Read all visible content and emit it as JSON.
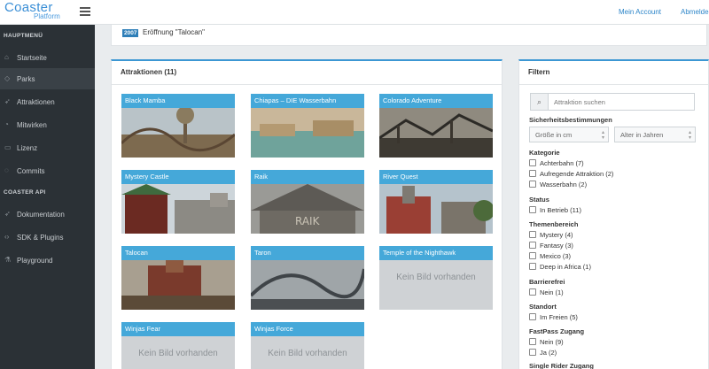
{
  "app": {
    "logo_main": "Coaster",
    "logo_sub": "Platform"
  },
  "topbar": {
    "account": "Mein Account",
    "logout": "Abmelde"
  },
  "sidebar": {
    "main_header": "HAUPTMENÜ",
    "main_items": [
      {
        "label": "Startseite",
        "icon": "home-icon"
      },
      {
        "label": "Parks",
        "icon": "tag-icon"
      },
      {
        "label": "Attraktionen",
        "icon": "rocket-icon"
      },
      {
        "label": "Mitwirken",
        "icon": "palette-icon"
      },
      {
        "label": "Lizenz",
        "icon": "chat-icon"
      },
      {
        "label": "Commits",
        "icon": "commit-icon"
      }
    ],
    "api_header": "COASTER API",
    "api_items": [
      {
        "label": "Dokumentation",
        "icon": "rocket-icon"
      },
      {
        "label": "SDK & Plugins",
        "icon": "code-icon"
      },
      {
        "label": "Playground",
        "icon": "flask-icon"
      }
    ]
  },
  "news": {
    "year": "2007",
    "text": "Eröffnung \"Talocan\""
  },
  "attractions": {
    "title": "Attraktionen (11)",
    "no_image": "Kein Bild vorhanden",
    "cards": [
      {
        "name": "Black Mamba"
      },
      {
        "name": "Chiapas – DIE Wasserbahn"
      },
      {
        "name": "Colorado Adventure"
      },
      {
        "name": "Mystery Castle"
      },
      {
        "name": "Raik"
      },
      {
        "name": "River Quest"
      },
      {
        "name": "Talocan"
      },
      {
        "name": "Taron"
      },
      {
        "name": "Temple of the Nighthawk"
      },
      {
        "name": "Winjas Fear"
      },
      {
        "name": "Winjas Force"
      }
    ]
  },
  "filter": {
    "title": "Filtern",
    "search_placeholder": "Attraktion suchen",
    "safety": {
      "label": "Sicherheitsbestimmungen",
      "size": "Größe in cm",
      "age": "Alter in Jahren"
    },
    "category": {
      "label": "Kategorie",
      "options": [
        "Achterbahn (7)",
        "Aufregende Attraktion (2)",
        "Wasserbahn (2)"
      ]
    },
    "status": {
      "label": "Status",
      "options": [
        "In Betrieb (11)"
      ]
    },
    "theme": {
      "label": "Themenbereich",
      "options": [
        "Mystery (4)",
        "Fantasy (3)",
        "Mexico (3)",
        "Deep in Africa (1)"
      ]
    },
    "barrier": {
      "label": "Barrierefrei",
      "options": [
        "Nein (1)"
      ]
    },
    "location": {
      "label": "Standort",
      "options": [
        "Im Freien (5)"
      ]
    },
    "fastpass": {
      "label": "FastPass Zugang",
      "options": [
        "Nein (9)",
        "Ja (2)"
      ]
    },
    "single": {
      "label": "Single Rider Zugang"
    }
  },
  "colors": {
    "accent": "#3c97d3",
    "card_caption": "#45a8d9",
    "sidebar": "#2b3136"
  }
}
